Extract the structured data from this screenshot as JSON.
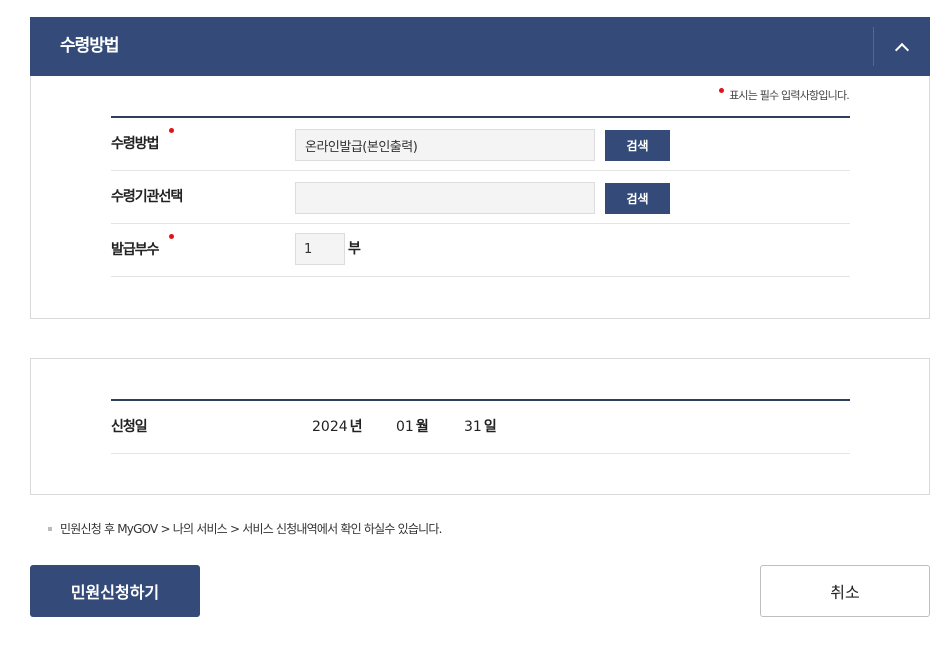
{
  "section": {
    "title": "수령방법",
    "collapse_icon": "chevron-up-icon"
  },
  "required_note": "표시는 필수 입력사항입니다.",
  "form": {
    "method": {
      "label": "수령방법",
      "value": "온라인발급(본인출력)",
      "button": "검색"
    },
    "agency": {
      "label": "수령기관선택",
      "value": "",
      "button": "검색"
    },
    "copies": {
      "label": "발급부수",
      "value": "1",
      "unit": "부"
    }
  },
  "application_date": {
    "label": "신청일",
    "year": "2024",
    "year_unit": "년",
    "month": "01",
    "month_unit": "월",
    "day": "31",
    "day_unit": "일"
  },
  "notice": "민원신청 후 MyGOV > 나의 서비스 > 서비스 신청내역에서 확인 하실수 있습니다.",
  "buttons": {
    "submit": "민원신청하기",
    "cancel": "취소"
  },
  "colors": {
    "primary": "#344b79",
    "required": "#e0131a"
  }
}
